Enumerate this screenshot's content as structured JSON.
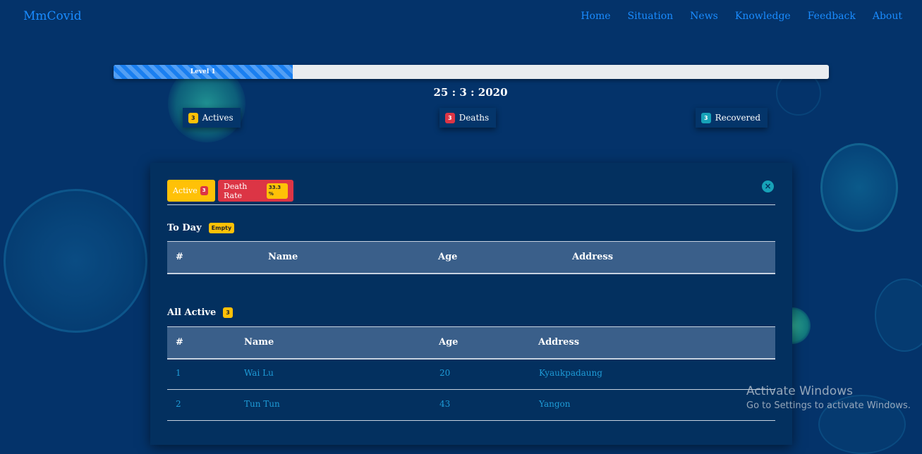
{
  "nav": {
    "brand": "MmCovid",
    "links": [
      "Home",
      "Situation",
      "News",
      "Knowledge",
      "Feedback",
      "About"
    ]
  },
  "progress": {
    "label": "Level 1",
    "fraction": 0.25,
    "color": "#1a7ff0"
  },
  "date": "25 : 3 : 2020",
  "stats": {
    "actives": {
      "count": "3",
      "label": "Actives"
    },
    "deaths": {
      "count": "3",
      "label": "Deaths"
    },
    "recovered": {
      "count": "3",
      "label": "Recovered"
    }
  },
  "card": {
    "active_btn": {
      "label": "Active",
      "count": "3"
    },
    "rate_btn": {
      "label": "Death Rate",
      "value": "33.3 %"
    },
    "close_icon": "close-icon",
    "today": {
      "title": "To Day",
      "badge": "Empty"
    },
    "all": {
      "title": "All Active",
      "badge": "3"
    },
    "columns": [
      "#",
      "Name",
      "Age",
      "Address"
    ],
    "rows": [
      {
        "no": "1",
        "name": "Wai Lu",
        "age": "20",
        "address": "Kyaukpadaung"
      },
      {
        "no": "2",
        "name": "Tun Tun",
        "age": "43",
        "address": "Yangon"
      }
    ]
  },
  "watermark": {
    "line1": "Activate Windows",
    "line2": "Go to Settings to activate Windows."
  },
  "colors": {
    "background": "#04336a",
    "card": "#03305f",
    "warning": "#ffc107",
    "danger": "#dc3545",
    "info": "#17a2b8",
    "link": "#1a8cff"
  }
}
